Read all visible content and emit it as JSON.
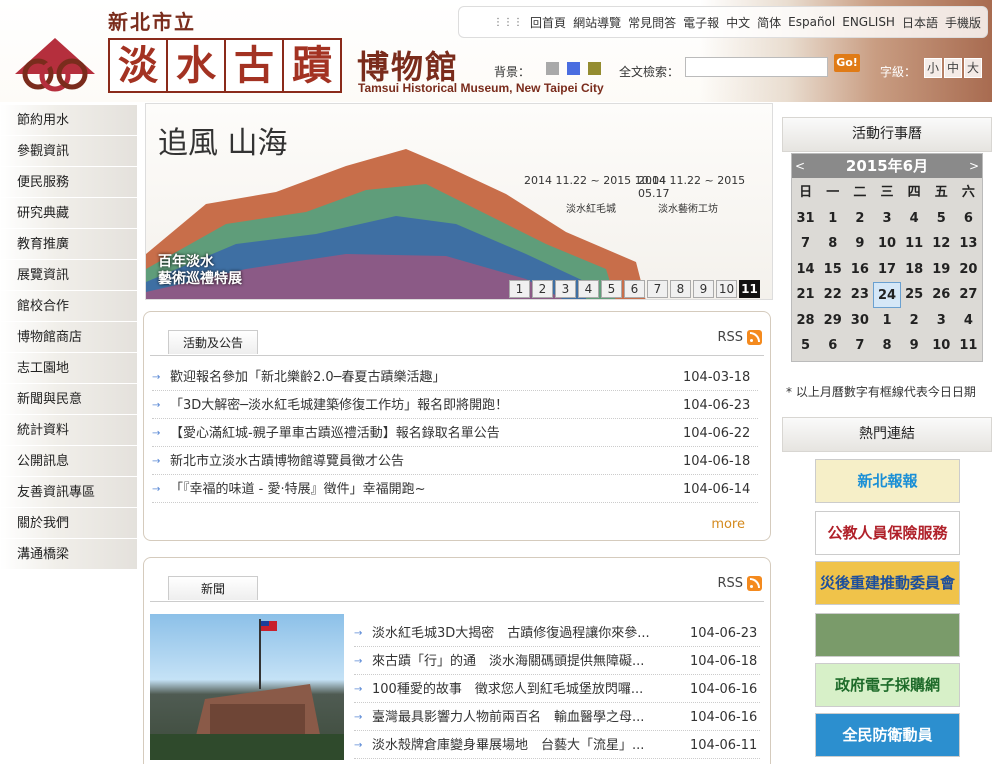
{
  "header": {
    "org_name": "新北市立",
    "title_chars": [
      "淡",
      "水",
      "古",
      "蹟"
    ],
    "title_rest": "博物館",
    "subtitle": "Tamsui Historical Museum, New Taipei City",
    "top_links": [
      "回首頁",
      "網站導覽",
      "常見問答",
      "電子報",
      "中文",
      "简体",
      "Español",
      "ENGLISH",
      "日本語",
      "手機版"
    ],
    "bg_label": "背景：",
    "swatch_colors": [
      "#a9a9a9",
      "#4a6de0",
      "#948c30"
    ],
    "search_label": "全文檢索：",
    "search_value": "",
    "go_label": "Go!",
    "font_label": "字級：",
    "font_sizes": [
      "小",
      "中",
      "大"
    ]
  },
  "nav": [
    "節約用水",
    "參觀資訊",
    "便民服務",
    "研究典藏",
    "教育推廣",
    "展覽資訊",
    "館校合作",
    "博物館商店",
    "志工園地",
    "新聞與民意",
    "統計資料",
    "公開訊息",
    "友善資訊專區",
    "關於我們",
    "溝通橋梁"
  ],
  "banner": {
    "title": "追風 山海",
    "caption_line1": "百年淡水",
    "caption_line2": "藝術巡禮特展",
    "exhibit1_dates": "2014 11.22 ~ 2015 10.04",
    "exhibit1_venue": "淡水紅毛城",
    "exhibit2_dates": "2014 11.22 ~ 2015 05.17",
    "exhibit2_venue": "淡水藝術工坊",
    "pages": [
      "1",
      "2",
      "3",
      "4",
      "5",
      "6",
      "7",
      "8",
      "9",
      "10",
      "11"
    ],
    "active_page": "11"
  },
  "announcements": {
    "tab": "活動及公告",
    "rss": "RSS",
    "items": [
      {
        "text": "歡迎報名參加「新北樂齡2.0─春夏古蹟樂活趣」",
        "date": "104-03-18"
      },
      {
        "text": "「3D大解密─淡水紅毛城建築修復工作坊」報名即將開跑！",
        "date": "104-06-23"
      },
      {
        "text": "【愛心滿紅城-親子單車古蹟巡禮活動】報名錄取名單公告",
        "date": "104-06-22"
      },
      {
        "text": "新北市立淡水古蹟博物館導覽員徵才公告",
        "date": "104-06-18"
      },
      {
        "text": "「『幸福的味道 - 愛‧特展』徵件」幸福開跑~",
        "date": "104-06-14"
      }
    ],
    "more": "more"
  },
  "news": {
    "tab": "新聞",
    "rss": "RSS",
    "items": [
      {
        "text": "淡水紅毛城3D大揭密　古蹟修復過程讓你來參...",
        "date": "104-06-23"
      },
      {
        "text": "來古蹟「行」的通　淡水海關碼頭提供無障礙...",
        "date": "104-06-18"
      },
      {
        "text": "100種愛的故事　徵求您人到紅毛城堡放閃囉...",
        "date": "104-06-16"
      },
      {
        "text": "臺灣最具影響力人物前兩百名　輸血醫學之母...",
        "date": "104-06-16"
      },
      {
        "text": "淡水殼牌倉庫變身畢展場地　台藝大「流星」...",
        "date": "104-06-11"
      }
    ]
  },
  "calendar": {
    "heading": "活動行事曆",
    "month_label": "2015年6月",
    "prev": "<",
    "next": ">",
    "weekdays": [
      "日",
      "一",
      "二",
      "三",
      "四",
      "五",
      "六"
    ],
    "days": [
      "31",
      "1",
      "2",
      "3",
      "4",
      "5",
      "6",
      "7",
      "8",
      "9",
      "10",
      "11",
      "12",
      "13",
      "14",
      "15",
      "16",
      "17",
      "18",
      "19",
      "20",
      "21",
      "22",
      "23",
      "24",
      "25",
      "26",
      "27",
      "28",
      "29",
      "30",
      "1",
      "2",
      "3",
      "4",
      "5",
      "6",
      "7",
      "8",
      "9",
      "10",
      "11"
    ],
    "today": "24",
    "note": "* 以上月曆數字有框線代表今日日期"
  },
  "hot_links": {
    "heading": "熱門連結",
    "items": [
      {
        "label": "新北報報",
        "color": "#1a8fd6",
        "bg": "#f6efc8"
      },
      {
        "label": "公教人員保險服務",
        "color": "#b0212a",
        "bg": "#ffffff"
      },
      {
        "label": "災後重建推動委員會",
        "color": "#1d4f9c",
        "bg": "#f0c34a"
      },
      {
        "label": "",
        "color": "#ffffff",
        "bg": "#7a9b6a"
      },
      {
        "label": "政府電子採購網",
        "color": "#1e6b2a",
        "bg": "#d7f0c8"
      },
      {
        "label": "全民防衛動員",
        "color": "#ffffff",
        "bg": "#2c8fcf"
      }
    ]
  }
}
